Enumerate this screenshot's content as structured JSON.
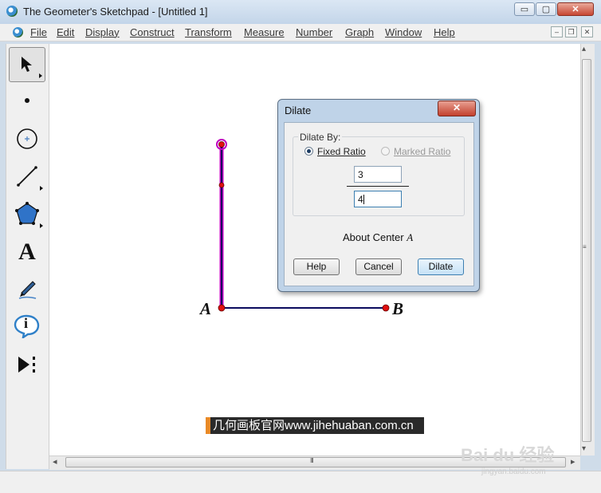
{
  "window": {
    "title": "The Geometer's Sketchpad - [Untitled 1]",
    "minimize": "▭",
    "maximize": "▢",
    "close": "✕"
  },
  "menu": {
    "items": [
      "File",
      "Edit",
      "Display",
      "Construct",
      "Transform",
      "Measure",
      "Number",
      "Graph",
      "Window",
      "Help"
    ],
    "mdi_minimize": "–",
    "mdi_restore": "❐",
    "mdi_close": "✕"
  },
  "toolbox": {
    "tools": [
      "arrow-tool",
      "point-tool",
      "compass-tool",
      "straightedge-tool",
      "polygon-tool",
      "text-tool",
      "marker-tool",
      "information-tool",
      "custom-tool"
    ],
    "text_tool_glyph": "A",
    "info_tool_glyph": "i"
  },
  "sketch": {
    "points": [
      "A",
      "B"
    ],
    "label_a": "A",
    "label_b": "B",
    "segment_color": "#0b0b5e",
    "point_color": "#e01010",
    "selection_color": "#c000c0"
  },
  "dialog": {
    "title": "Dilate",
    "close": "✕",
    "group_label": "Dilate By:",
    "option_fixed": "Fixed Ratio",
    "option_marked": "Marked Ratio",
    "selected_option": "Fixed Ratio",
    "numerator": "3",
    "denominator": "4",
    "center_text": "About Center",
    "center_point": "A",
    "help_label": "Help",
    "cancel_label": "Cancel",
    "dilate_label": "Dilate"
  },
  "scrollbar": {
    "grip": "III",
    "left_arrow": "◂",
    "right_arrow": "▸",
    "up_arrow": "▴",
    "down_arrow": "▾"
  },
  "watermark": {
    "text": "几何画板官网www.jihehuaban.com.cn",
    "logo": "Bai du 经验",
    "url": "jingyan.baidu.com"
  }
}
